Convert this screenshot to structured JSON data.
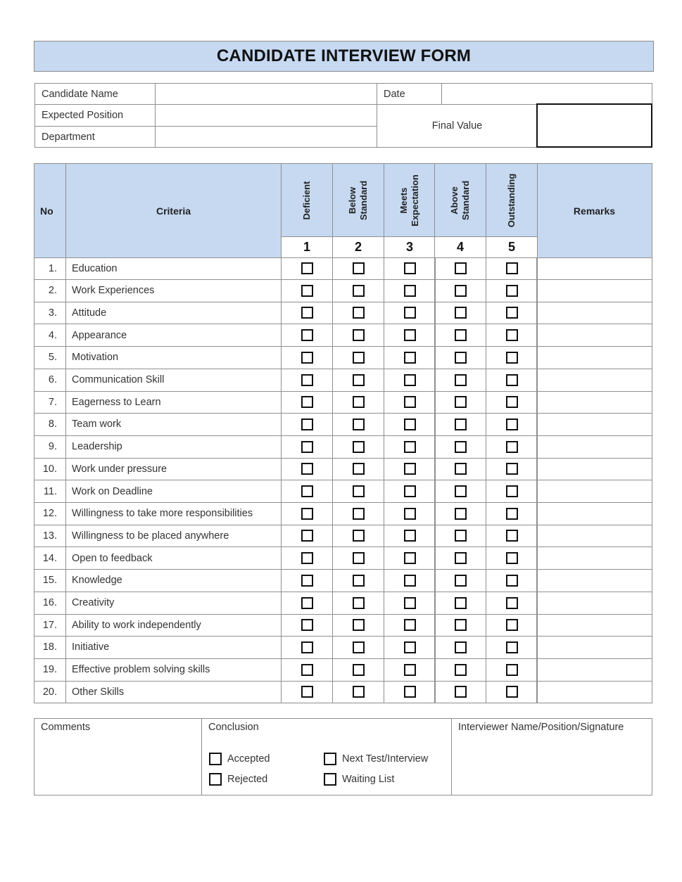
{
  "form": {
    "title": "CANDIDATE INTERVIEW FORM",
    "header_color": "#c6d9f1"
  },
  "info": {
    "candidate_name_label": "Candidate Name",
    "candidate_name_value": "",
    "expected_position_label": "Expected Position",
    "expected_position_value": "",
    "department_label": "Department",
    "department_value": "",
    "date_label": "Date",
    "date_value": "",
    "final_value_label": "Final Value",
    "final_value_value": ""
  },
  "table": {
    "col_no": "No",
    "col_criteria": "Criteria",
    "col_remarks": "Remarks",
    "ratings": [
      {
        "label": "Deficient",
        "score": "1"
      },
      {
        "label": "Below\nStandard",
        "score": "2"
      },
      {
        "label": "Meets\nExpectation",
        "score": "3"
      },
      {
        "label": "Above\nStandard",
        "score": "4"
      },
      {
        "label": "Outstanding",
        "score": "5"
      }
    ],
    "rows": [
      {
        "no": "1.",
        "criteria": "Education"
      },
      {
        "no": "2.",
        "criteria": "Work Experiences"
      },
      {
        "no": "3.",
        "criteria": "Attitude"
      },
      {
        "no": "4.",
        "criteria": "Appearance"
      },
      {
        "no": "5.",
        "criteria": "Motivation"
      },
      {
        "no": "6.",
        "criteria": "Communication Skill"
      },
      {
        "no": "7.",
        "criteria": "Eagerness to Learn"
      },
      {
        "no": "8.",
        "criteria": "Team work"
      },
      {
        "no": "9.",
        "criteria": "Leadership"
      },
      {
        "no": "10.",
        "criteria": "Work under pressure"
      },
      {
        "no": "11.",
        "criteria": "Work on Deadline"
      },
      {
        "no": "12.",
        "criteria": "Willingness to take more responsibilities"
      },
      {
        "no": "13.",
        "criteria": "Willingness to be placed anywhere"
      },
      {
        "no": "14.",
        "criteria": "Open to feedback"
      },
      {
        "no": "15.",
        "criteria": "Knowledge"
      },
      {
        "no": "16.",
        "criteria": "Creativity"
      },
      {
        "no": "17.",
        "criteria": "Ability to work independently"
      },
      {
        "no": "18.",
        "criteria": "Initiative"
      },
      {
        "no": "19.",
        "criteria": "Effective problem solving skills"
      },
      {
        "no": "20.",
        "criteria": "Other Skills"
      }
    ]
  },
  "bottom": {
    "comments_label": "Comments",
    "conclusion_label": "Conclusion",
    "interviewer_label": "Interviewer Name/Position/Signature",
    "options": {
      "accepted": "Accepted",
      "rejected": "Rejected",
      "next_test": "Next Test/Interview",
      "waiting_list": "Waiting List"
    }
  }
}
